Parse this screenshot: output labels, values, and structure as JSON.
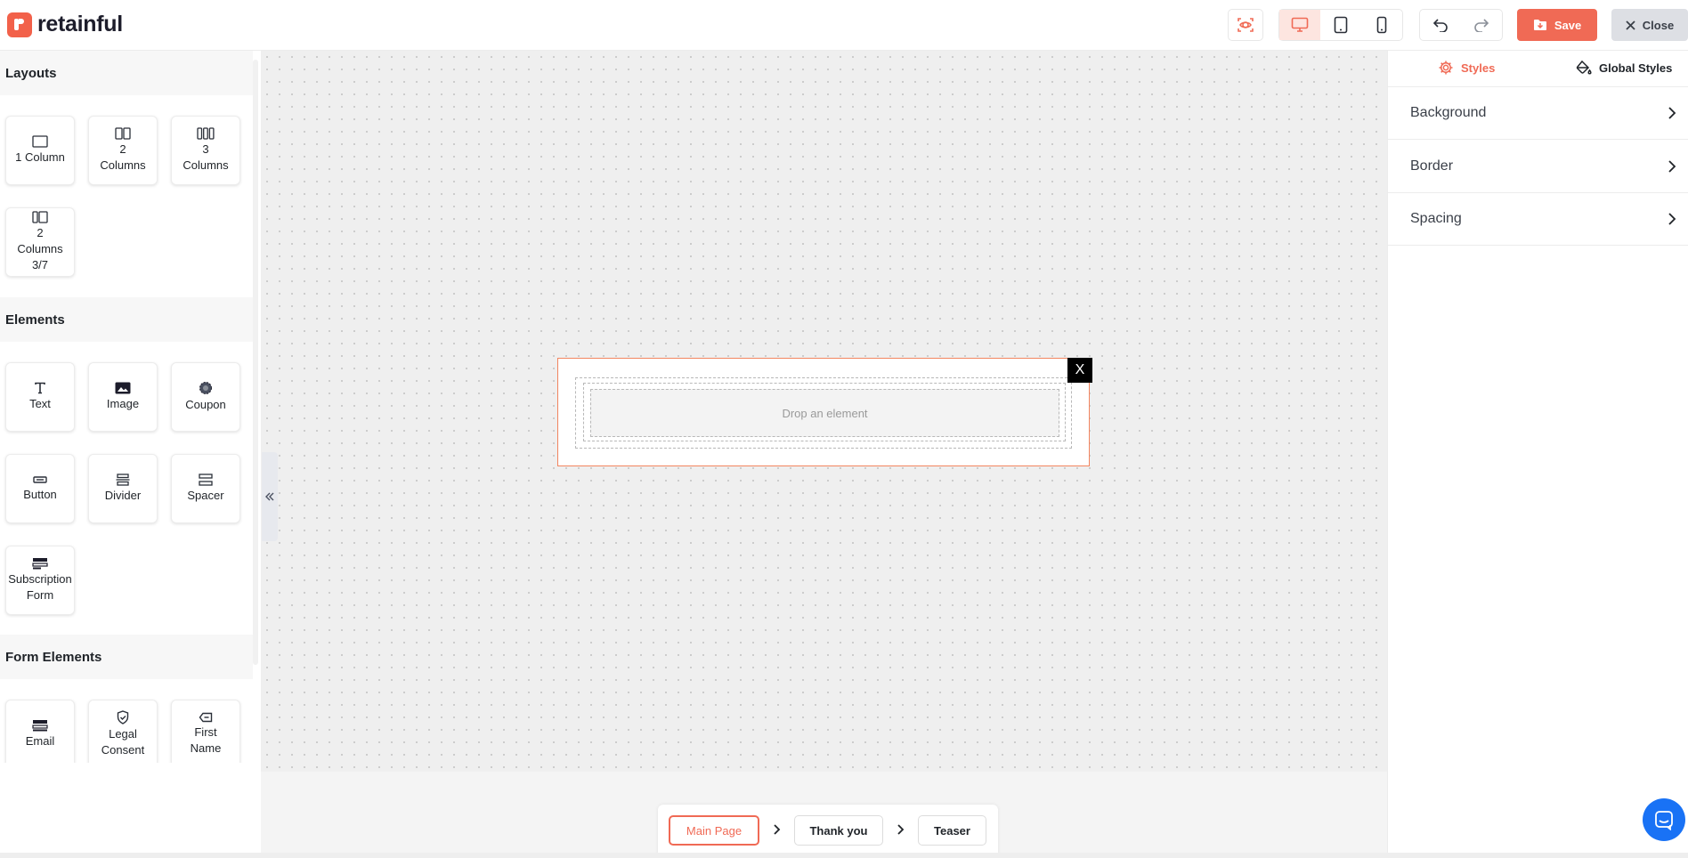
{
  "app": {
    "brand": "retainful"
  },
  "header": {
    "save_label": "Save",
    "close_label": "Close",
    "active_device": "desktop"
  },
  "sidebar": {
    "sections": [
      {
        "title": "Layouts"
      },
      {
        "title": "Elements"
      },
      {
        "title": "Form Elements"
      }
    ],
    "layouts": [
      {
        "label": "1 Column",
        "icon": "one-column-icon"
      },
      {
        "label": "2 Columns",
        "icon": "two-columns-icon"
      },
      {
        "label": "3 Columns",
        "icon": "three-columns-icon"
      },
      {
        "label": "2 Columns 3/7",
        "icon": "two-columns-3-7-icon"
      }
    ],
    "elements": [
      {
        "label": "Text",
        "icon": "text-icon"
      },
      {
        "label": "Image",
        "icon": "image-icon"
      },
      {
        "label": "Coupon",
        "icon": "coupon-icon"
      },
      {
        "label": "Button",
        "icon": "button-icon"
      },
      {
        "label": "Divider",
        "icon": "divider-icon"
      },
      {
        "label": "Spacer",
        "icon": "spacer-icon"
      },
      {
        "label": "Subscription Form",
        "icon": "subscription-form-icon"
      }
    ],
    "form_elements": [
      {
        "label": "Email",
        "icon": "email-icon"
      },
      {
        "label": "Legal Consent",
        "icon": "shield-icon"
      },
      {
        "label": "First Name",
        "icon": "tag-icon"
      }
    ]
  },
  "canvas": {
    "popup_close": "X",
    "drop_placeholder": "Drop an element"
  },
  "pages": {
    "items": [
      {
        "label": "Main Page",
        "active": true
      },
      {
        "label": "Thank you",
        "active": false
      },
      {
        "label": "Teaser",
        "active": false
      }
    ]
  },
  "right_panel": {
    "tabs": [
      {
        "label": "Styles",
        "active": true,
        "icon": "gear-icon"
      },
      {
        "label": "Global Styles",
        "active": false,
        "icon": "paint-bucket-icon"
      }
    ],
    "accordions": [
      {
        "label": "Background"
      },
      {
        "label": "Border"
      },
      {
        "label": "Spacing"
      }
    ]
  },
  "colors": {
    "accent": "#f06a55",
    "active_bg": "#fde5e0",
    "chat_blue": "#1972f5"
  }
}
